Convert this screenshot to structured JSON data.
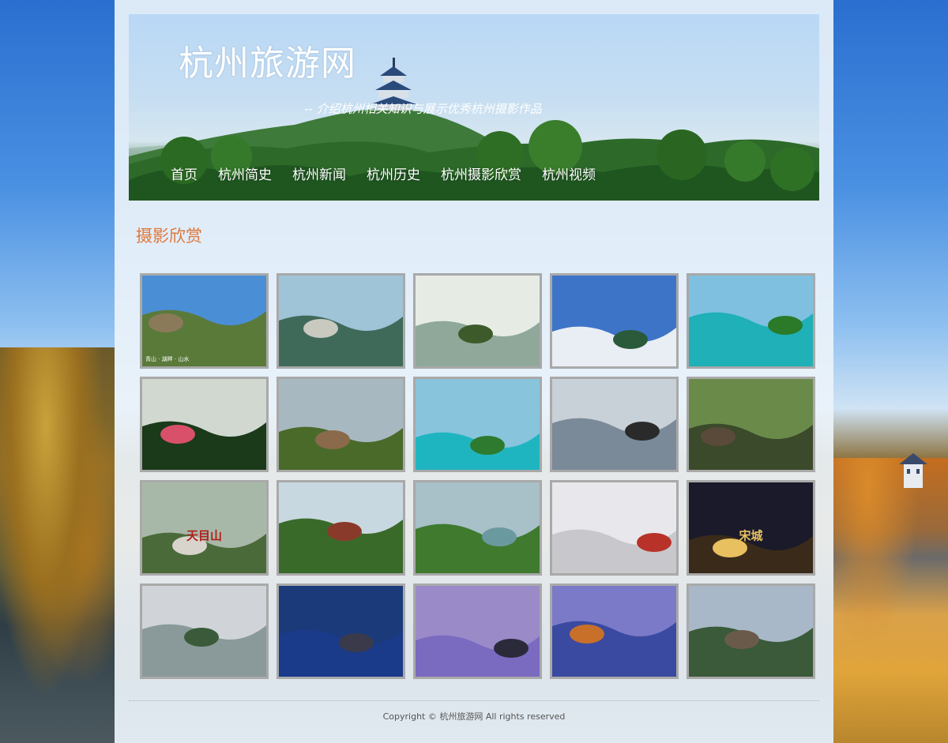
{
  "header": {
    "site_title": "杭州旅游网",
    "tagline": "-- 介绍杭州相关知识与展示优秀杭州摄影作品"
  },
  "nav": {
    "items": [
      {
        "label": "首页"
      },
      {
        "label": "杭州简史"
      },
      {
        "label": "杭州新闻"
      },
      {
        "label": "杭州历史"
      },
      {
        "label": "杭州摄影欣赏"
      },
      {
        "label": "杭州视频"
      }
    ]
  },
  "main": {
    "section_title": "摄影欣赏",
    "photos": [
      {
        "sky": "#4a8fd6",
        "ground": "#5a7a3a",
        "accent": "#8a7a5a",
        "caption": "青山 · 湖畔 · 山水"
      },
      {
        "sky": "#9fc4d8",
        "ground": "#3f6a5a",
        "accent": "#c9c9c0"
      },
      {
        "sky": "#e6ece4",
        "ground": "#8fa89a",
        "accent": "#3d5a2a"
      },
      {
        "sky": "#3d74c8",
        "ground": "#e8eef4",
        "accent": "#2a5a3a"
      },
      {
        "sky": "#7fc0e0",
        "ground": "#1fb0b8",
        "accent": "#2a7a2a"
      },
      {
        "sky": "#d0d8d0",
        "ground": "#1a3a1a",
        "accent": "#d9506a"
      },
      {
        "sky": "#a8b8c0",
        "ground": "#4a6a2a",
        "accent": "#8a6a4a"
      },
      {
        "sky": "#88c4dc",
        "ground": "#1fb5c0",
        "accent": "#2e7a2e"
      },
      {
        "sky": "#c8d0d8",
        "ground": "#7a8a98",
        "accent": "#2a2a2a"
      },
      {
        "sky": "#6a8a4a",
        "ground": "#3a4a2a",
        "accent": "#5a4a3a"
      },
      {
        "sky": "#a8b8a8",
        "ground": "#4a6a3a",
        "accent": "#d8d4cc",
        "sign": "天目山"
      },
      {
        "sky": "#c8d8e0",
        "ground": "#3a6a2a",
        "accent": "#8a3a2a"
      },
      {
        "sky": "#a8c0c8",
        "ground": "#3f7a2f",
        "accent": "#6a9aa0"
      },
      {
        "sky": "#e8e8ec",
        "ground": "#c8c8cc",
        "accent": "#b8322a"
      },
      {
        "sky": "#1a1a2a",
        "ground": "#3a2a1a",
        "accent": "#e8c060",
        "sign": "宋城"
      },
      {
        "sky": "#d0d4d8",
        "ground": "#8a9a9a",
        "accent": "#3a5a3a"
      },
      {
        "sky": "#1a3a7a",
        "ground": "#1a3a8a",
        "accent": "#3a3a4a"
      },
      {
        "sky": "#9a8ac8",
        "ground": "#7a6ac0",
        "accent": "#2a2a3a"
      },
      {
        "sky": "#7a7ac8",
        "ground": "#3a4aa0",
        "accent": "#c8702a"
      },
      {
        "sky": "#a8b8c8",
        "ground": "#3a5a3a",
        "accent": "#6a5a4a"
      }
    ]
  },
  "footer": {
    "copyright": "Copyright © 杭州旅游网 All rights reserved"
  },
  "colors": {
    "section_title": "#e0773a",
    "thumb_border": "#a9a9a9",
    "container_bg": "#ecf3fa"
  }
}
